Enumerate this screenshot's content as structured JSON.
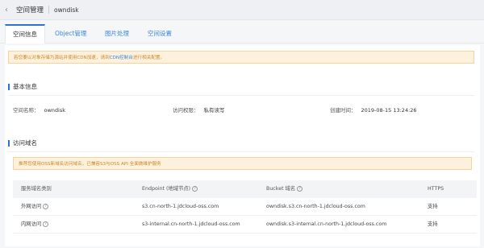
{
  "header": {
    "title": "空间管理",
    "bucket_name": "owndisk"
  },
  "tabs": [
    {
      "label": "空间信息",
      "active": true
    },
    {
      "label": "Object管理",
      "active": false
    },
    {
      "label": "图片处理",
      "active": false
    },
    {
      "label": "空间设置",
      "active": false
    }
  ],
  "notice": {
    "text": "若您要以对象存储为源站并使用CDN加速，请到",
    "link": "CDN控制台",
    "suffix": "进行相关配置。"
  },
  "basic": {
    "title": "基本信息",
    "name_label": "空间名称：",
    "name_value": "owndisk",
    "access_label": "访问权限：",
    "access_value": "私有读写",
    "created_label": "创建时间：",
    "created_value": "2019-08-15 13:24:26"
  },
  "domains": {
    "title": "访问域名",
    "notice": "推荐您使用OSS新域名访问域名，已兼容S3与OSS API 全面做维护服务",
    "headers": [
      "服务域名类别",
      "Endpoint (地域节点)",
      "Bucket 域名",
      "HTTPS"
    ],
    "rows": [
      {
        "type": "外网访问",
        "endpoint": "s3.cn-north-1.jdcloud-oss.com",
        "bucket": "owndisk.s3.cn-north-1.jdcloud-oss.com",
        "https": "支持"
      },
      {
        "type": "内网访问",
        "endpoint": "s3-internal.cn-north-1.jdcloud-oss.com",
        "bucket": "owndisk.s3-internal.cn-north-1.jdcloud-oss.com",
        "https": "支持"
      }
    ]
  },
  "colors": {
    "accent": "#2c72d2",
    "link": "#3c87d8",
    "warning_bg": "#fdf1dd",
    "warning_text": "#c98a2a"
  },
  "icons": {
    "back": "chevron-left-icon",
    "help": "question-circle-icon"
  }
}
